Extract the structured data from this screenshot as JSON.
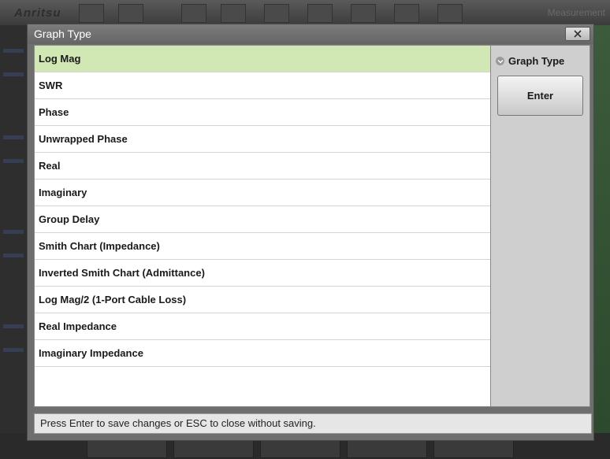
{
  "background": {
    "brand": "Anritsu",
    "menu_label": "Measurement"
  },
  "dialog": {
    "title": "Graph Type",
    "close_icon": "close-icon",
    "items": [
      {
        "label": "Log Mag",
        "selected": true
      },
      {
        "label": "SWR",
        "selected": false
      },
      {
        "label": "Phase",
        "selected": false
      },
      {
        "label": "Unwrapped Phase",
        "selected": false
      },
      {
        "label": "Real",
        "selected": false
      },
      {
        "label": "Imaginary",
        "selected": false
      },
      {
        "label": "Group Delay",
        "selected": false
      },
      {
        "label": "Smith Chart (Impedance)",
        "selected": false
      },
      {
        "label": "Inverted Smith Chart (Admittance)",
        "selected": false
      },
      {
        "label": "Log Mag/2 (1-Port Cable Loss)",
        "selected": false
      },
      {
        "label": "Real Impedance",
        "selected": false
      },
      {
        "label": "Imaginary Impedance",
        "selected": false
      }
    ],
    "side": {
      "label": "Graph Type",
      "icon": "chevron-down-icon",
      "enter_label": "Enter"
    },
    "status": "Press Enter to save changes or ESC to close without saving."
  },
  "colors": {
    "selected_row": "#d2e8b4",
    "title_text": "#ffffff"
  }
}
